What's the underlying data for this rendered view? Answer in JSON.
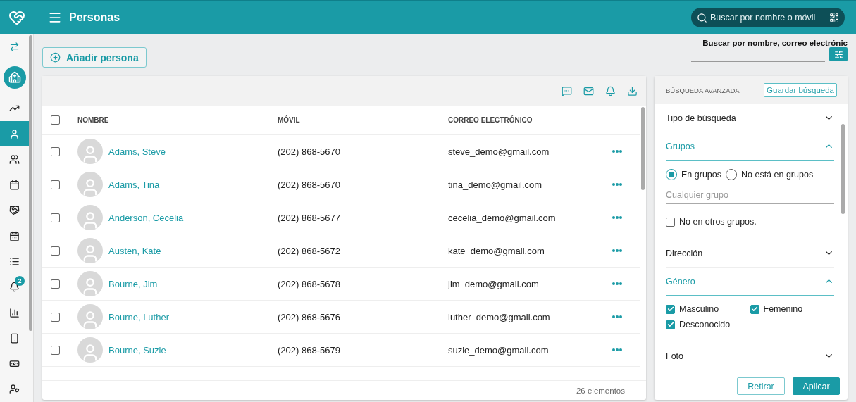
{
  "header": {
    "title": "Personas",
    "search": {
      "placeholder": "Buscar por nombre o móvil"
    }
  },
  "sidebar": {
    "items": [
      {
        "kind": "swap",
        "selected": false
      },
      {
        "kind": "org",
        "selected": false
      },
      {
        "kind": "trend",
        "selected": false
      },
      {
        "kind": "person",
        "selected": true
      },
      {
        "kind": "group",
        "selected": false
      },
      {
        "kind": "calendar",
        "selected": false
      },
      {
        "kind": "handshake",
        "selected": false
      },
      {
        "kind": "schedule",
        "selected": false
      },
      {
        "kind": "list",
        "selected": false
      },
      {
        "kind": "bell",
        "selected": false,
        "badge": "2"
      },
      {
        "kind": "chart",
        "selected": false
      },
      {
        "kind": "phone",
        "selected": false
      },
      {
        "kind": "money",
        "selected": false
      },
      {
        "kind": "usercog",
        "selected": false
      }
    ]
  },
  "add_button": "Añadir persona",
  "quick_search": {
    "label": "Buscar por nombre, correo electrónic"
  },
  "table": {
    "select_all_checked": false,
    "columns": [
      "NOMBRE",
      "MÓVIL",
      "CORREO ELECTRÓNICO"
    ],
    "rows": [
      {
        "checked": false,
        "name": "Adams, Steve",
        "mobile": "(202) 868-5670",
        "email": "steve_demo@gmail.com"
      },
      {
        "checked": false,
        "name": "Adams, Tina",
        "mobile": "(202) 868-5670",
        "email": "tina_demo@gmail.com"
      },
      {
        "checked": false,
        "name": "Anderson, Cecelia",
        "mobile": "(202) 868-5677",
        "email": "cecelia_demo@gmail.com"
      },
      {
        "checked": false,
        "name": "Austen, Kate",
        "mobile": "(202) 868-5672",
        "email": "kate_demo@gmail.com"
      },
      {
        "checked": false,
        "name": "Bourne, Jim",
        "mobile": "(202) 868-5678",
        "email": "jim_demo@gmail.com"
      },
      {
        "checked": false,
        "name": "Bourne, Luther",
        "mobile": "(202) 868-5676",
        "email": "luther_demo@gmail.com"
      },
      {
        "checked": false,
        "name": "Bourne, Suzie",
        "mobile": "(202) 868-5679",
        "email": "suzie_demo@gmail.com"
      }
    ],
    "footer": "26 elementos"
  },
  "advanced": {
    "title": "BÚSQUEDA AVANZADA",
    "save_button": "Guardar búsqueda",
    "sections": [
      {
        "kind": "header",
        "label": "Tipo de búsqueda",
        "expanded": false
      },
      {
        "kind": "header",
        "label": "Grupos",
        "expanded": true
      },
      {
        "kind": "radios",
        "options": [
          {
            "label": "En grupos",
            "selected": true
          },
          {
            "label": "No está en grupos",
            "selected": false
          }
        ]
      },
      {
        "kind": "field",
        "placeholder": "Cualquier grupo"
      },
      {
        "kind": "checks",
        "options": [
          {
            "label": "No en otros grupos.",
            "checked": false
          }
        ]
      },
      {
        "kind": "header",
        "label": "Dirección",
        "expanded": false
      },
      {
        "kind": "header",
        "label": "Género",
        "expanded": true
      },
      {
        "kind": "checks",
        "options": [
          {
            "label": "Masculino",
            "checked": true
          },
          {
            "label": "Femenino",
            "checked": true
          },
          {
            "label": "Desconocido",
            "checked": true
          }
        ]
      },
      {
        "kind": "header",
        "label": "Foto",
        "expanded": false
      }
    ],
    "buttons": [
      {
        "kind": "secondary",
        "label": "Retirar"
      },
      {
        "kind": "primary",
        "label": "Aplicar"
      }
    ]
  }
}
